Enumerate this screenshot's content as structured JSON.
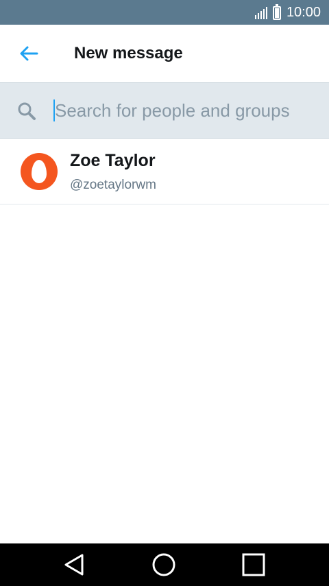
{
  "status_bar": {
    "time": "10:00",
    "icons": [
      "signal-icon",
      "battery-icon"
    ]
  },
  "app_bar": {
    "back_icon": "back-arrow-icon",
    "title": "New message"
  },
  "search": {
    "placeholder": "Search for people and groups",
    "value": "",
    "icon": "search-icon"
  },
  "results": [
    {
      "name": "Zoe Taylor",
      "handle": "@zoetaylorwm",
      "avatar_color": "#f4561f"
    }
  ],
  "nav_bar": {
    "buttons": [
      "back-triangle-icon",
      "home-circle-icon",
      "recents-square-icon"
    ]
  },
  "colors": {
    "status_bar": "#5b7a8f",
    "accent": "#1da1f2",
    "search_background": "#e1e8ed",
    "title_text": "#14171a",
    "secondary_text": "#657786"
  }
}
